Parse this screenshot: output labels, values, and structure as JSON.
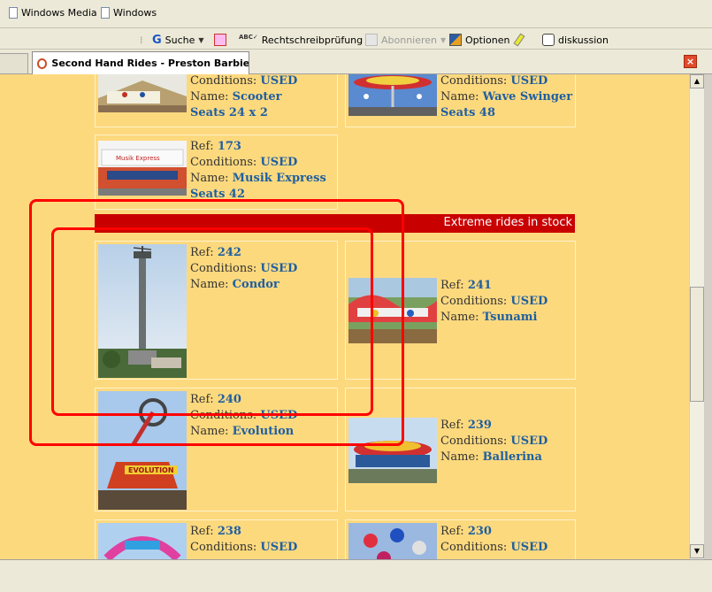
{
  "links_bar": {
    "items": [
      {
        "label": "Windows Media"
      },
      {
        "label": "Windows"
      }
    ]
  },
  "toolbar": {
    "search_label": "Suche",
    "spellcheck_label": "Rechtschreibprüfung",
    "subscribe_label": "Abonnieren",
    "options_label": "Optionen",
    "discussion_label": "diskussion"
  },
  "tab": {
    "title": "Second Hand Rides - Preston Barbier..."
  },
  "section": {
    "header": "Extreme rides in stock"
  },
  "labels": {
    "ref": "Ref:",
    "conditions": "Conditions:",
    "name": "Name:"
  },
  "rides": [
    {
      "conditions": "USED",
      "name": "Scooter",
      "extra": "Seats 24 x 2"
    },
    {
      "conditions": "USED",
      "name": "Wave Swinger",
      "extra": "Seats 48"
    },
    {
      "ref": "173",
      "conditions": "USED",
      "name": "Musik Express",
      "extra": "Seats 42"
    },
    {
      "ref": "242",
      "conditions": "USED",
      "name": "Condor"
    },
    {
      "ref": "241",
      "conditions": "USED",
      "name": "Tsunami"
    },
    {
      "ref": "240",
      "conditions": "USED",
      "name": "Evolution"
    },
    {
      "ref": "239",
      "conditions": "USED",
      "name": "Ballerina"
    },
    {
      "ref": "238",
      "conditions": "USED"
    },
    {
      "ref": "230",
      "conditions": "USED"
    }
  ],
  "colors": {
    "page_bg": "#fdd97e",
    "link_text": "#1f5fa0",
    "section_header_bg": "#c90000",
    "annotation": "#ff0000"
  }
}
